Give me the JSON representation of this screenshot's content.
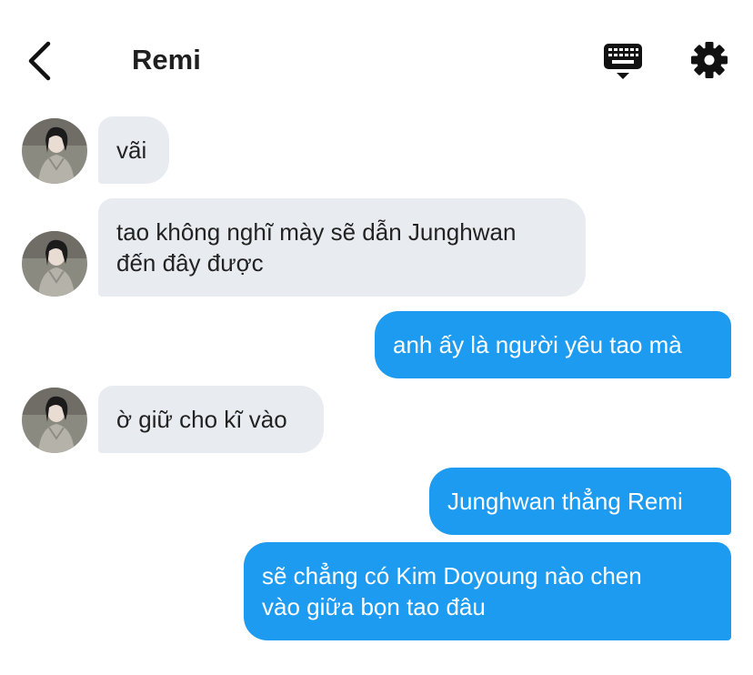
{
  "header": {
    "title": "Remi",
    "back_icon": "chevron-left-icon",
    "keyboard_icon": "keyboard-icon",
    "settings_icon": "gear-icon"
  },
  "messages": [
    {
      "direction": "incoming",
      "lines": [
        "vãi"
      ]
    },
    {
      "direction": "incoming",
      "lines": [
        "tao không nghĩ mày sẽ dẫn Junghwan",
        "đến đây được"
      ]
    },
    {
      "direction": "outgoing",
      "lines": [
        "anh ấy là người yêu tao mà"
      ]
    },
    {
      "direction": "incoming",
      "lines": [
        "ờ giữ cho kĩ vào"
      ]
    },
    {
      "direction": "outgoing",
      "lines": [
        "Junghwan thẳng Remi"
      ]
    },
    {
      "direction": "outgoing",
      "lines": [
        "sẽ chẳng có Kim Doyoung nào chen",
        "vào giữa bọn tao đâu"
      ]
    }
  ],
  "colors": {
    "incoming_bubble": "#e8ecf0",
    "outgoing_bubble": "#1d9bf0",
    "outgoing_text": "#ffffff"
  }
}
